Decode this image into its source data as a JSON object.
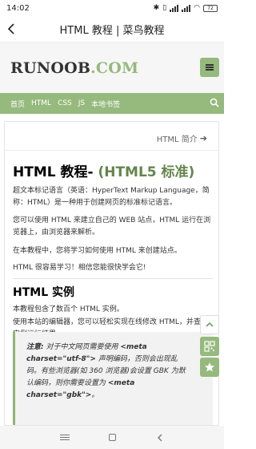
{
  "status_bar": {
    "time": "14:02",
    "battery": "72"
  },
  "titlebar": {
    "title": "HTML 教程 | 菜鸟教程"
  },
  "header": {
    "logo_main": "RUNOOB",
    "logo_com": ".COM"
  },
  "nav": {
    "items": [
      "首页",
      "HTML",
      "CSS",
      "JS",
      "本地书签"
    ]
  },
  "content": {
    "intro_link": "HTML 简介",
    "heading_main": "HTML 教程- ",
    "heading_sub": "(HTML5 标准)",
    "para1": "超文本标记语言（英语：HyperText Markup Language，简称：HTML）是一种用于创建网页的标准标记语言。",
    "para2": "您可以使用 HTML 来建立自己的 WEB 站点，HTML 运行在浏览器上，由浏览器来解析。",
    "para3": "在本教程中，您将学习如何使用 HTML 来创建站点。",
    "para4": "HTML 很容易学习！相信您能很快学会它!",
    "section_title": "HTML 实例",
    "para5": "本教程包含了数百个 HTML 实例。",
    "para6": "使用本站的编辑器，您可以轻松实现在线修改 HTML，并查看实例运行结果。",
    "note_label": "注意:",
    "note_text1": " 对于中文网页需要使用 ",
    "note_code1": "<meta charset=\"utf-8\">",
    "note_text2": " 声明编码，否则会出现乱码。有些浏览器(如 360 浏览器)会设置 GBK 为默认编码，则你需要设置为 ",
    "note_code2": "<meta charset=\"gbk\">",
    "note_text3": "。"
  },
  "colors": {
    "accent": "#96b97d",
    "heading_accent": "#64854c"
  },
  "icons": [
    "back-arrow-icon",
    "menu-icon",
    "search-icon",
    "arrow-right-icon",
    "chevron-up-icon",
    "qr-code-icon",
    "star-icon"
  ]
}
